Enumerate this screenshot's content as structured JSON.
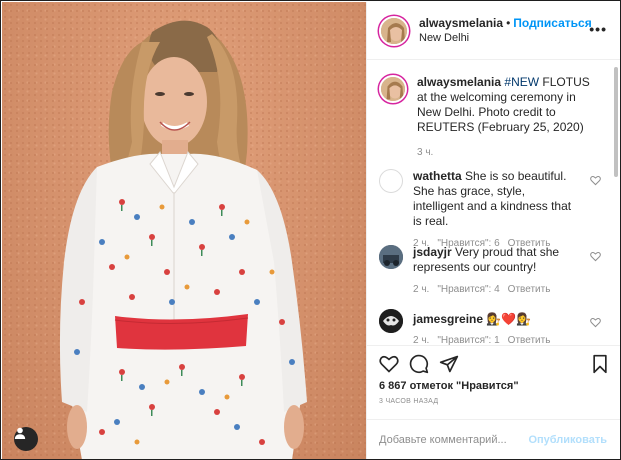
{
  "post": {
    "username": "alwaysmelania",
    "follow_label": "Подписаться",
    "location": "New Delhi",
    "more_label": "•••"
  },
  "caption": {
    "username": "alwaysmelania",
    "hashtag": "#NEW",
    "text": " FLOTUS at the welcoming ceremony in New Delhi. Photo credit to REUTERS (February 25, 2020)",
    "time": "3 ч."
  },
  "comments": [
    {
      "username": "wathetta",
      "text": " She is so beautiful. She has grace, style, intelligent and a kindness that is real.",
      "time": "2 ч.",
      "likes": "\"Нравится\": 6",
      "reply": "Ответить",
      "avatar_color": "#ffffff"
    },
    {
      "username": "jsdayjr",
      "text": " Very proud that she represents our country!",
      "time": "2 ч.",
      "likes": "\"Нравится\": 4",
      "reply": "Ответить",
      "avatar_color": "#3a4a5a"
    },
    {
      "username": "jamesgreine",
      "text": " 👩‍⚖️❤️👩‍⚖️",
      "time": "2 ч.",
      "likes": "\"Нравится\": 1",
      "reply": "Ответить",
      "avatar_color": "#222222"
    }
  ],
  "actions": {
    "like_icon": "heart-icon",
    "comment_icon": "comment-icon",
    "share_icon": "share-icon",
    "save_icon": "bookmark-icon",
    "likes_count": "6 867 отметок \"Нравится\"",
    "time_ago": "3 ЧАСОВ НАЗАД"
  },
  "comment_box": {
    "placeholder": "Добавьте комментарий...",
    "publish_label": "Опубликовать"
  },
  "colors": {
    "accent": "#0095f6",
    "publish_disabled": "#b2dffc",
    "muted": "#8e8e8e",
    "hashtag": "#00376b"
  }
}
